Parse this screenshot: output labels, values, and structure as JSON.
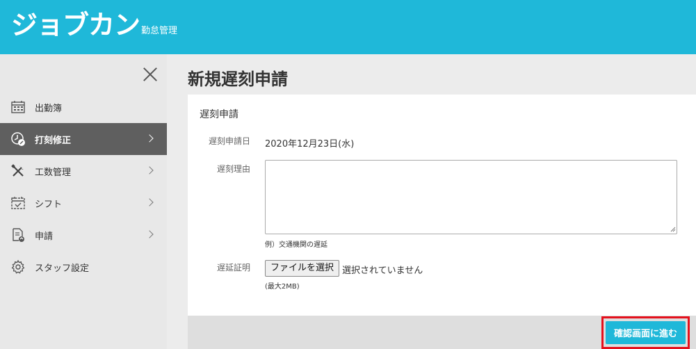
{
  "header": {
    "logo": "ジョブカン",
    "logo_sub": "勤怠管理"
  },
  "sidebar": {
    "items": [
      {
        "label": "出勤簿",
        "icon": "calendar-grid-icon",
        "chevron": false
      },
      {
        "label": "打刻修正",
        "icon": "clock-edit-icon",
        "chevron": true,
        "active": true
      },
      {
        "label": "工数管理",
        "icon": "tools-icon",
        "chevron": true
      },
      {
        "label": "シフト",
        "icon": "calendar-check-icon",
        "chevron": true
      },
      {
        "label": "申請",
        "icon": "document-upload-icon",
        "chevron": true
      },
      {
        "label": "スタッフ設定",
        "icon": "gear-icon",
        "chevron": false
      }
    ]
  },
  "main": {
    "page_title": "新規遅刻申請",
    "card": {
      "title": "遅刻申請",
      "date_label": "遅刻申請日",
      "date_value": "2020年12月23日(水)",
      "reason_label": "遅刻理由",
      "reason_value": "",
      "reason_hint": "例）交通機関の遅延",
      "proof_label": "遅延証明",
      "file_button": "ファイルを選択",
      "file_status": "選択されていません",
      "max_size": "(最大2MB)"
    },
    "confirm_button": "確認画面に進む"
  },
  "colors": {
    "accent": "#1fb8d9",
    "highlight": "#e5101c",
    "sidebar_active": "#5f5f5f"
  }
}
